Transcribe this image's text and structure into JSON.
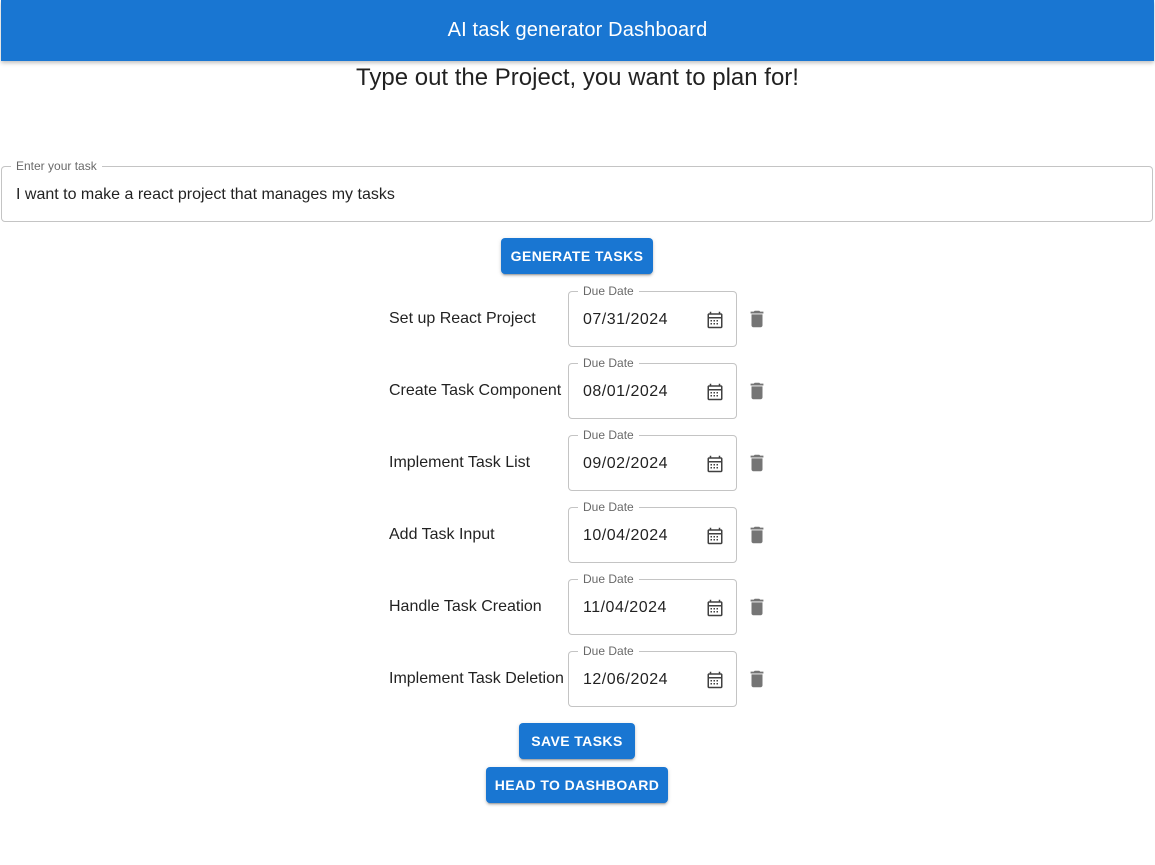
{
  "appbar": {
    "title": "AI task generator Dashboard",
    "color": "#1976d2"
  },
  "headline": "Type out the Project, you want to plan for!",
  "task_input": {
    "label": "Enter your task",
    "value": "I want to make a react project that manages my tasks"
  },
  "buttons": {
    "generate": "Generate Tasks",
    "save": "Save Tasks",
    "dashboard": "Head to Dashboard"
  },
  "tasks": [
    {
      "name": "Set up React Project",
      "date_label": "Due Date",
      "due": "07/31/2024"
    },
    {
      "name": "Create Task Component",
      "date_label": "Due Date",
      "due": "08/01/2024"
    },
    {
      "name": "Implement Task List",
      "date_label": "Due Date",
      "due": "09/02/2024"
    },
    {
      "name": "Add Task Input",
      "date_label": "Due Date",
      "due": "10/04/2024"
    },
    {
      "name": "Handle Task Creation",
      "date_label": "Due Date",
      "due": "11/04/2024"
    },
    {
      "name": "Implement Task Deletion",
      "date_label": "Due Date",
      "due": "12/06/2024"
    }
  ],
  "icons": {
    "calendar": "calendar-icon",
    "delete": "trash-icon"
  }
}
